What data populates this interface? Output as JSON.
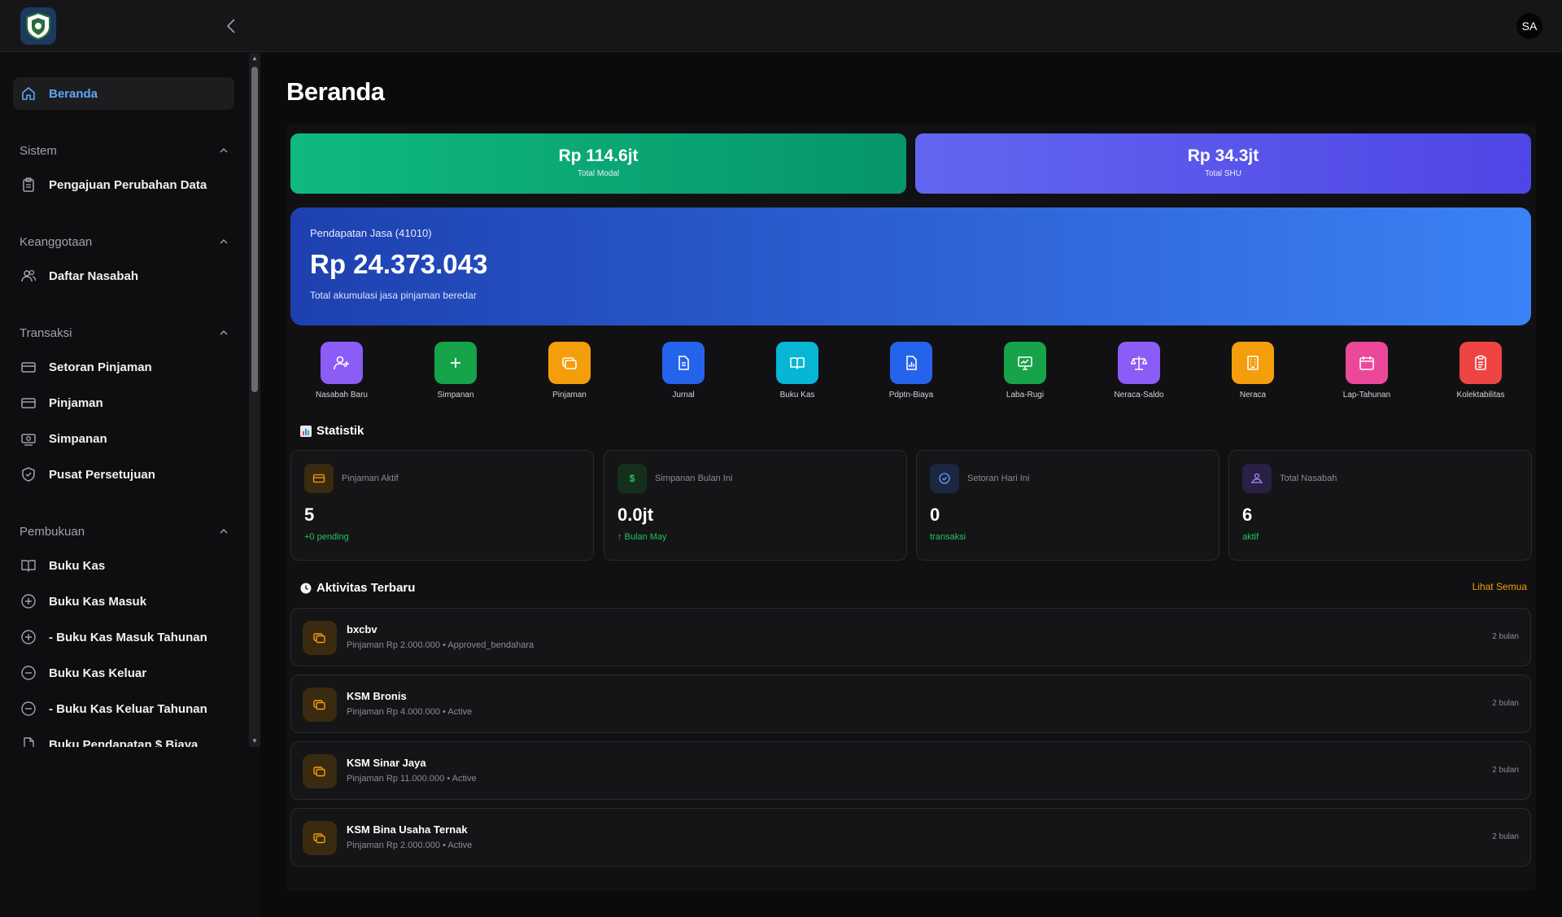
{
  "header": {
    "avatar_initials": "SA"
  },
  "sidebar": {
    "home": "Beranda",
    "sections": [
      {
        "title": "Sistem",
        "items": [
          "Pengajuan Perubahan Data"
        ]
      },
      {
        "title": "Keanggotaan",
        "items": [
          "Daftar Nasabah"
        ]
      },
      {
        "title": "Transaksi",
        "items": [
          "Setoran Pinjaman",
          "Pinjaman",
          "Simpanan",
          "Pusat Persetujuan"
        ]
      },
      {
        "title": "Pembukuan",
        "items": [
          "Buku Kas",
          "Buku Kas Masuk",
          "- Buku Kas Masuk Tahunan",
          "Buku Kas Keluar",
          "- Buku Kas Keluar Tahunan",
          "Buku Pendapatan $ Biaya"
        ]
      }
    ]
  },
  "main": {
    "title": "Beranda",
    "summary": [
      {
        "value": "Rp 114.6jt",
        "label": "Total Modal"
      },
      {
        "value": "Rp 34.3jt",
        "label": "Total SHU"
      }
    ],
    "hero": {
      "title": "Pendapatan Jasa (41010)",
      "value": "Rp 24.373.043",
      "subtitle": "Total akumulasi jasa pinjaman beredar"
    },
    "quick_actions": [
      {
        "label": "Nasabah Baru",
        "color": "#8b5cf6"
      },
      {
        "label": "Simpanan",
        "color": "#16a34a"
      },
      {
        "label": "Pinjaman",
        "color": "#f59e0b"
      },
      {
        "label": "Jurnal",
        "color": "#2563eb"
      },
      {
        "label": "Buku Kas",
        "color": "#06b6d4"
      },
      {
        "label": "Pdptn-Biaya",
        "color": "#2563eb"
      },
      {
        "label": "Laba-Rugi",
        "color": "#16a34a"
      },
      {
        "label": "Neraca-Saldo",
        "color": "#8b5cf6"
      },
      {
        "label": "Neraca",
        "color": "#f59e0b"
      },
      {
        "label": "Lap-Tahunan",
        "color": "#ec4899"
      },
      {
        "label": "Kolektabilitas",
        "color": "#ef4444"
      }
    ],
    "stats_title": "Statistik",
    "stats": [
      {
        "label": "Pinjaman Aktif",
        "value": "5",
        "sub": "+0 pending"
      },
      {
        "label": "Simpanan Bulan Ini",
        "value": "0.0jt",
        "sub": "↑ Bulan May"
      },
      {
        "label": "Setoran Hari Ini",
        "value": "0",
        "sub": "transaksi"
      },
      {
        "label": "Total Nasabah",
        "value": "6",
        "sub": "aktif"
      }
    ],
    "activity_title": "Aktivitas Terbaru",
    "see_all": "Lihat Semua",
    "activities": [
      {
        "name": "bxcbv",
        "detail": "Pinjaman Rp 2.000.000 • Approved_bendahara",
        "time": "2 bulan"
      },
      {
        "name": "KSM Bronis",
        "detail": "Pinjaman Rp 4.000.000 • Active",
        "time": "2 bulan"
      },
      {
        "name": "KSM Sinar Jaya",
        "detail": "Pinjaman Rp 11.000.000 • Active",
        "time": "2 bulan"
      },
      {
        "name": "KSM Bina Usaha Ternak",
        "detail": "Pinjaman Rp 2.000.000 • Active",
        "time": "2 bulan"
      }
    ]
  }
}
